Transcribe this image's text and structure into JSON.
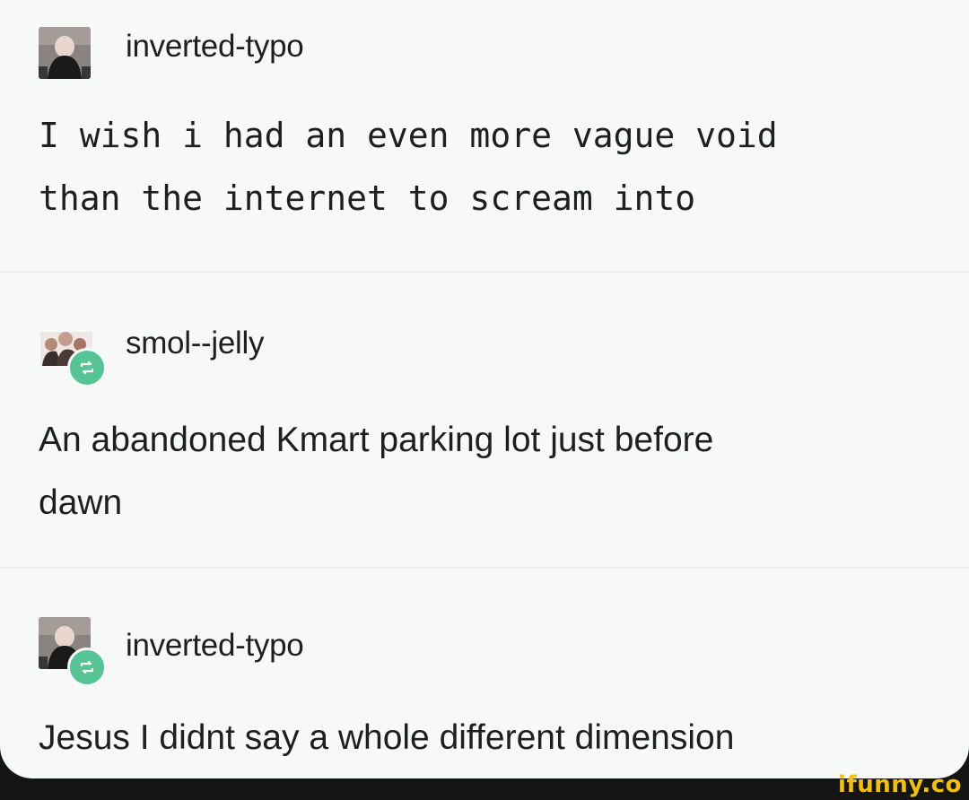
{
  "posts": [
    {
      "username": "inverted-typo",
      "text": "I wish i had an even more vague void than the internet to scream into",
      "text_line1": "I wish i had an even more vague void",
      "text_line2": "than the internet to scream into",
      "reblogged": false,
      "avatar_icon": "avatar-hooded-figure-icon"
    },
    {
      "username": "smol--jelly",
      "text_line1": "An abandoned Kmart parking lot just before",
      "text_line2": "dawn",
      "reblogged": true,
      "avatar_icon": "avatar-group-icon"
    },
    {
      "username": "inverted-typo",
      "text_line1": "Jesus I didnt say a whole different dimension",
      "reblogged": true,
      "avatar_icon": "avatar-hooded-figure-icon"
    }
  ],
  "watermark": "ifunny.co",
  "colors": {
    "background": "#f7f8f8",
    "text": "#1f1f1f",
    "reblog_badge": "#56c494",
    "watermark": "#f2c200",
    "frame": "#151515"
  }
}
